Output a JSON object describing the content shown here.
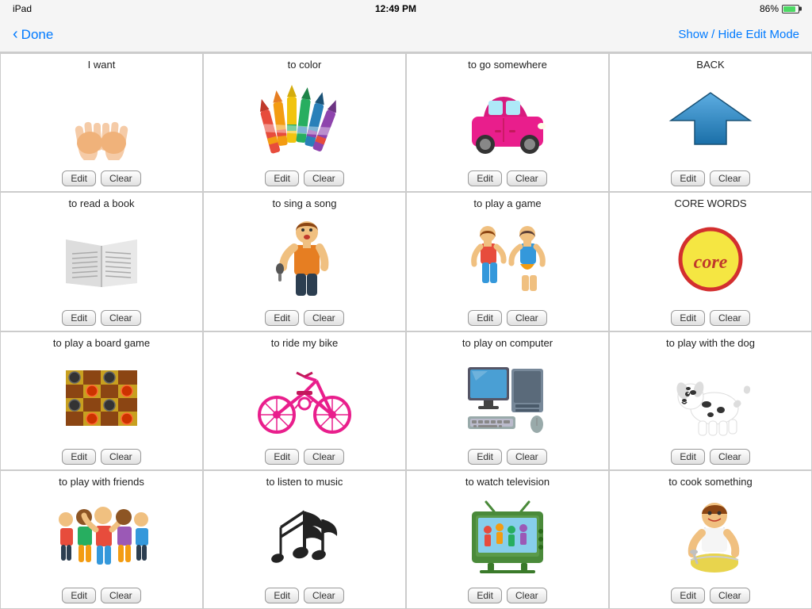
{
  "statusBar": {
    "device": "iPad",
    "time": "12:49 PM",
    "battery": "86%"
  },
  "navBar": {
    "backLabel": "Done",
    "editModeLabel": "Show / Hide Edit Mode"
  },
  "cells": [
    {
      "id": "i-want",
      "label": "I want",
      "imageType": "hands",
      "editLabel": "Edit",
      "clearLabel": "Clear"
    },
    {
      "id": "to-color",
      "label": "to color",
      "imageType": "crayons",
      "editLabel": "Edit",
      "clearLabel": "Clear"
    },
    {
      "id": "to-go-somewhere",
      "label": "to go somewhere",
      "imageType": "car",
      "editLabel": "Edit",
      "clearLabel": "Clear"
    },
    {
      "id": "back",
      "label": "BACK",
      "imageType": "back-arrow",
      "editLabel": "Edit",
      "clearLabel": "Clear"
    },
    {
      "id": "to-read-a-book",
      "label": "to read a book",
      "imageType": "book",
      "editLabel": "Edit",
      "clearLabel": "Clear"
    },
    {
      "id": "to-sing-a-song",
      "label": "to sing a song",
      "imageType": "singer",
      "editLabel": "Edit",
      "clearLabel": "Clear"
    },
    {
      "id": "to-play-a-game",
      "label": "to play a game",
      "imageType": "dancing-kids",
      "editLabel": "Edit",
      "clearLabel": "Clear"
    },
    {
      "id": "core-words",
      "label": "CORE WORDS",
      "imageType": "core-badge",
      "editLabel": "Edit",
      "clearLabel": "Clear"
    },
    {
      "id": "to-play-board-game",
      "label": "to play a board game",
      "imageType": "checkers",
      "editLabel": "Edit",
      "clearLabel": "Clear"
    },
    {
      "id": "to-ride-bike",
      "label": "to ride my bike",
      "imageType": "bike",
      "editLabel": "Edit",
      "clearLabel": "Clear"
    },
    {
      "id": "to-play-computer",
      "label": "to play on computer",
      "imageType": "computer",
      "editLabel": "Edit",
      "clearLabel": "Clear"
    },
    {
      "id": "to-play-dog",
      "label": "to play with the dog",
      "imageType": "dog",
      "editLabel": "Edit",
      "clearLabel": "Clear"
    },
    {
      "id": "to-play-friends",
      "label": "to play with friends",
      "imageType": "kids-group",
      "editLabel": "Edit",
      "clearLabel": "Clear"
    },
    {
      "id": "to-listen-music",
      "label": "to listen to music",
      "imageType": "music-notes",
      "editLabel": "Edit",
      "clearLabel": "Clear"
    },
    {
      "id": "to-watch-tv",
      "label": "to watch television",
      "imageType": "tv",
      "editLabel": "Edit",
      "clearLabel": "Clear"
    },
    {
      "id": "to-cook",
      "label": "to cook something",
      "imageType": "cooking",
      "editLabel": "Edit",
      "clearLabel": "Clear"
    }
  ]
}
